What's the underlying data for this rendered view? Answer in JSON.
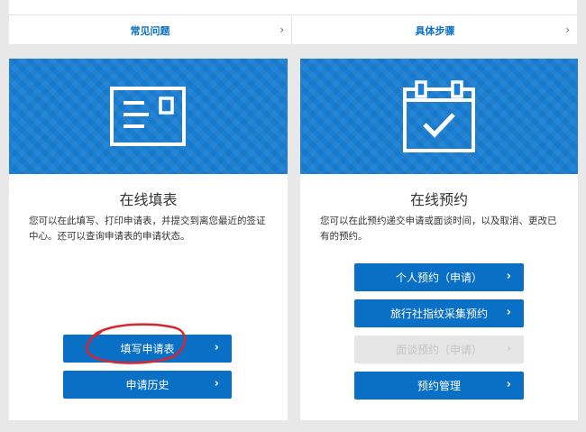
{
  "top_links": [
    {
      "label": "常见问题"
    },
    {
      "label": "具体步骤"
    }
  ],
  "chevron": "›",
  "cards": [
    {
      "title": "在线填表",
      "description": "您可以在此填写、打印申请表，并提交到离您最近的签证中心。还可以查询申请表的申请状态。",
      "icon": "application-form-icon",
      "buttons": [
        {
          "label": "填写申请表",
          "enabled": true
        },
        {
          "label": "申请历史",
          "enabled": true
        }
      ]
    },
    {
      "title": "在线预约",
      "description": "您可以在此预约递交申请或面谈时间，以及取消、更改已有的预约。",
      "icon": "calendar-check-icon",
      "buttons": [
        {
          "label": "个人预约（申请）",
          "enabled": true
        },
        {
          "label": "旅行社指纹采集预约",
          "enabled": true
        },
        {
          "label": "面谈预约（申请）",
          "enabled": false
        },
        {
          "label": "预约管理",
          "enabled": true
        }
      ]
    }
  ],
  "colors": {
    "accent": "#0a70c6",
    "banner": "#1a7fd4",
    "disabled_bg": "#e6e6e6",
    "annotation": "#d9262c"
  }
}
